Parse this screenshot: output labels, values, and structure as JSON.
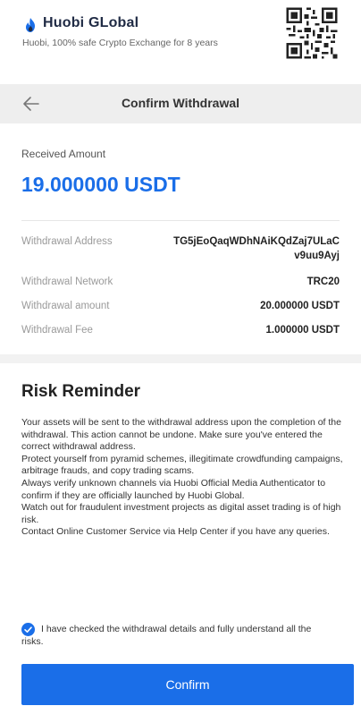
{
  "brand": {
    "name": "Huobi GLobal",
    "tagline": "Huobi, 100% safe Crypto Exchange for 8 years"
  },
  "navbar": {
    "title": "Confirm Withdrawal"
  },
  "amount": {
    "label": "Received Amount",
    "value": "19.000000 USDT"
  },
  "details": [
    {
      "label": "Withdrawal Address",
      "value": "TG5jEoQaqWDhNAiKQdZaj7ULaCv9uu9Ayj"
    },
    {
      "label": "Withdrawal Network",
      "value": "TRC20"
    },
    {
      "label": "Withdrawal amount",
      "value": "20.000000 USDT"
    },
    {
      "label": "Withdrawal Fee",
      "value": "1.000000 USDT"
    }
  ],
  "risk": {
    "title": "Risk Reminder",
    "lines": [
      "Your assets will be sent to the withdrawal address upon the completion of the withdrawal. This action cannot be undone. Make sure you've entered the correct withdrawal address.",
      "Protect yourself from pyramid schemes, illegitimate crowdfunding campaigns, arbitrage frauds, and copy trading scams.",
      "Always verify unknown channels via Huobi Official Media Authenticator to confirm if they are officially launched by Huobi Global.",
      "Watch out for fraudulent investment projects as digital asset trading is of high risk.",
      "Contact Online Customer Service via Help Center if you have any queries."
    ]
  },
  "agreement": {
    "checked": true,
    "text": "I have checked the withdrawal details and fully understand all the risks."
  },
  "confirm_button": {
    "label": "Confirm"
  },
  "colors": {
    "accent": "#1a6ee8",
    "navbar_bg": "#eeeeee"
  },
  "icons": {
    "logo": "huobi-flame-icon",
    "qr": "qr-code-icon",
    "back": "back-arrow-icon",
    "check": "checkbox-checked-icon"
  }
}
